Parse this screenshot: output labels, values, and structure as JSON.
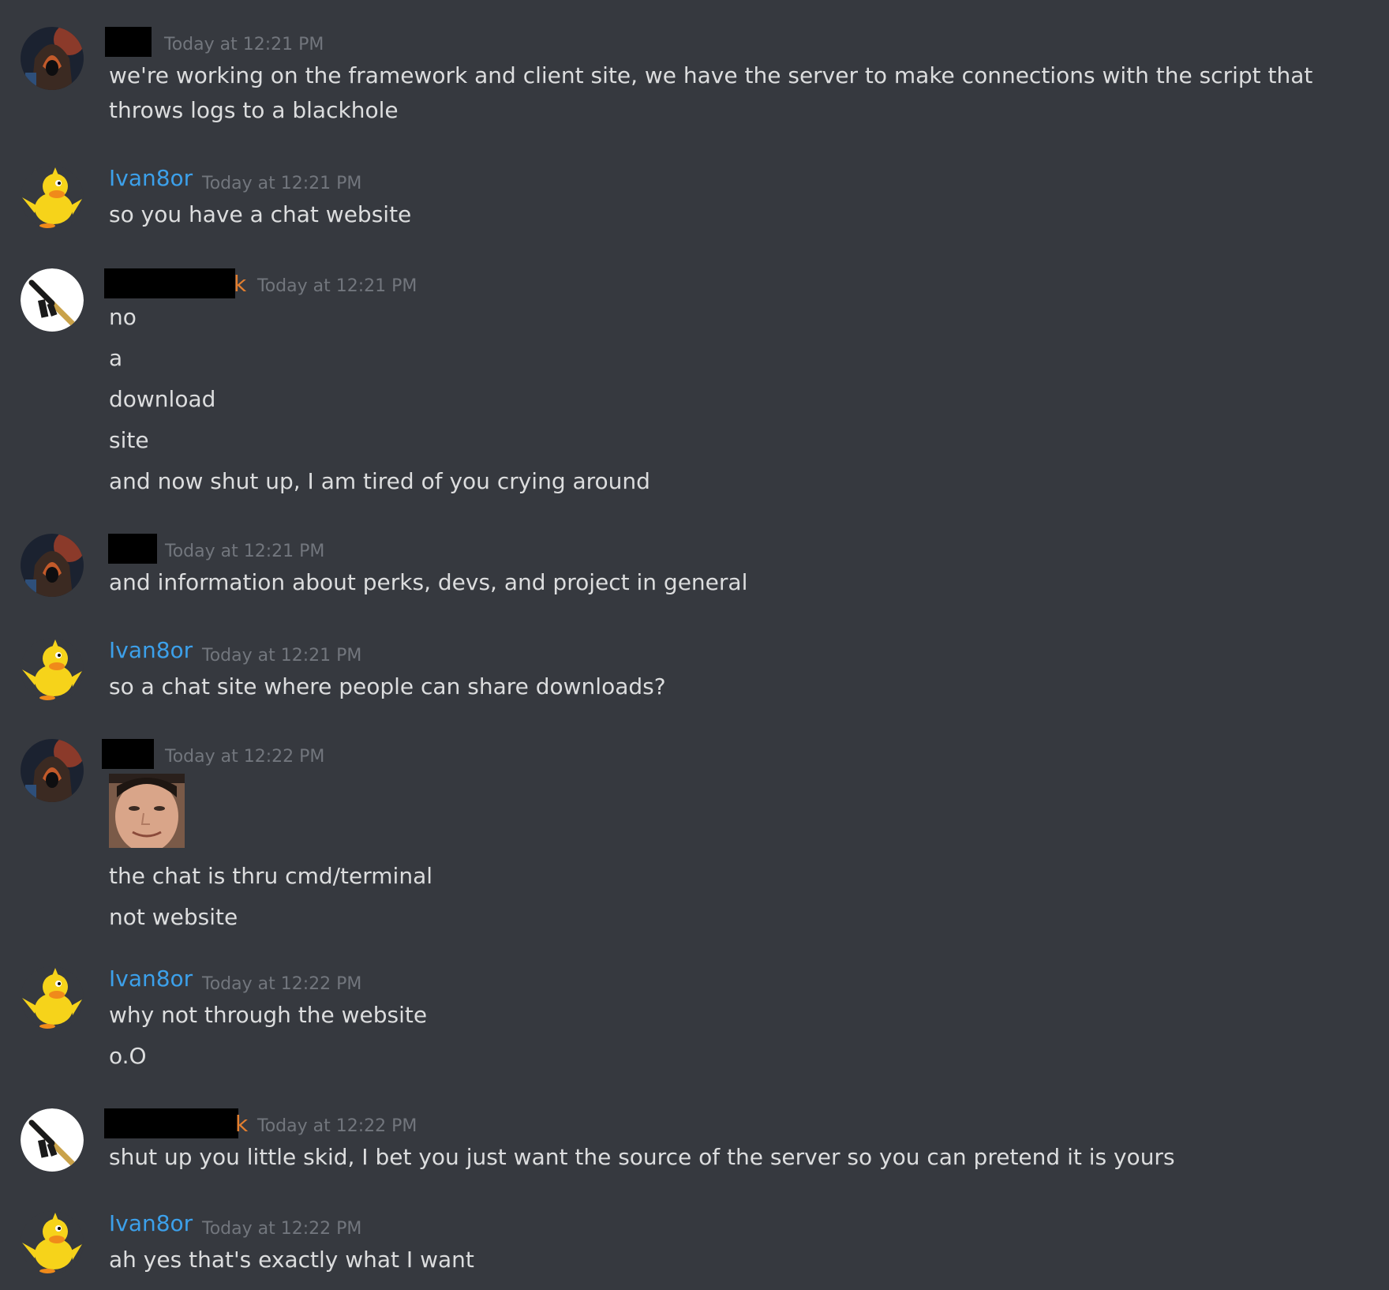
{
  "conversation": [
    {
      "author": "",
      "author_visible_suffix": "",
      "timestamp": "Today at 12:21 PM",
      "avatar_icon": "hooded-figure-avatar",
      "lines": [
        "we're working on the framework and client site, we have the server to make connections with the script that throws logs to a blackhole"
      ]
    },
    {
      "author": "Ivan8or",
      "timestamp": "Today at 12:21 PM",
      "avatar_icon": "yellow-duck-avatar",
      "lines": [
        "so you have a chat website"
      ]
    },
    {
      "author_visible_suffix": "k",
      "timestamp": "Today at 12:21 PM",
      "avatar_icon": "rifle-avatar",
      "lines": [
        "no",
        "a",
        "download",
        "site",
        "and now shut up, I am tired of you crying around"
      ]
    },
    {
      "timestamp": "Today at 12:21 PM",
      "avatar_icon": "hooded-figure-avatar",
      "lines": [
        "and information about perks, devs, and project in general"
      ]
    },
    {
      "author": "Ivan8or",
      "timestamp": "Today at 12:21 PM",
      "avatar_icon": "yellow-duck-avatar",
      "lines": [
        "so a chat site where people can share downloads?"
      ]
    },
    {
      "timestamp": "Today at 12:22 PM",
      "avatar_icon": "hooded-figure-avatar",
      "emoji": "smiling-face-emoji",
      "lines": [
        "the chat is thru cmd/terminal",
        "not website"
      ]
    },
    {
      "author": "Ivan8or",
      "timestamp": "Today at 12:22 PM",
      "avatar_icon": "yellow-duck-avatar",
      "lines": [
        "why not through the website",
        "o.O"
      ]
    },
    {
      "author_visible_suffix": "k",
      "timestamp": "Today at 12:22 PM",
      "avatar_icon": "rifle-avatar",
      "lines": [
        "shut up you little skid, I bet you just want the source of the server so you can pretend it is yours"
      ]
    },
    {
      "author": "Ivan8or",
      "timestamp": "Today at 12:22 PM",
      "avatar_icon": "yellow-duck-avatar",
      "lines": [
        "ah yes that's exactly what I want"
      ]
    }
  ],
  "colors": {
    "background": "#36393f",
    "text": "#dcddde",
    "timestamp": "#72767d",
    "author_ivan": "#3ca0ea",
    "author_orange": "#e47f2f"
  }
}
